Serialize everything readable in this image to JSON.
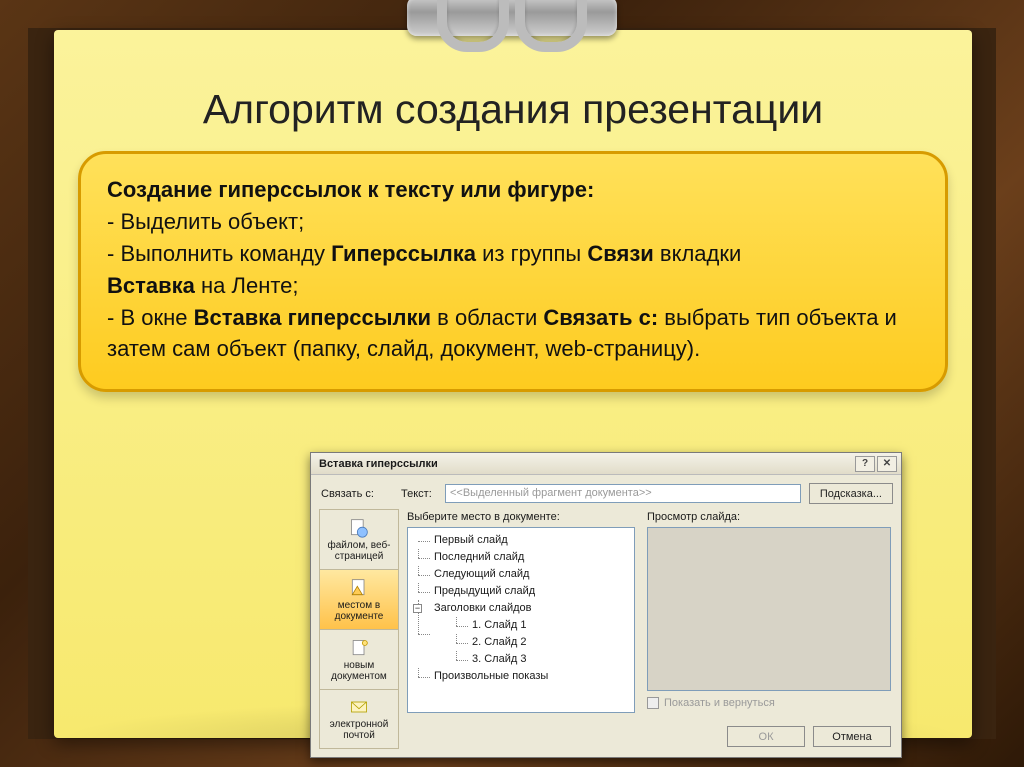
{
  "slide": {
    "title": "Алгоритм создания презентации",
    "heading": "Создание гиперссылок к тексту или фигуре:",
    "step1": "-  Выделить объект;",
    "step2_a": "-  Выполнить команду  ",
    "step2_b": "Гиперссылка",
    "step2_c": " из группы  ",
    "step2_d": "Связи",
    "step2_e": " вкладки ",
    "step2_f": "Вставка",
    "step2_g": " на Ленте;",
    "step3_a": "-  В окне ",
    "step3_b": "Вставка гиперссылки",
    "step3_c": " в области ",
    "step3_d": "Связать с:",
    "step3_e": " выбрать тип объекта и затем сам объект (папку, слайд, документ, web-страницу)."
  },
  "dialog": {
    "title": "Вставка гиперссылки",
    "link_to_label": "Связать с:",
    "text_label": "Текст:",
    "text_placeholder": "<<Выделенный фрагмент документа>>",
    "hint_btn": "Подсказка...",
    "linkto": {
      "file": "файлом, веб-страницей",
      "place": "местом в документе",
      "newdoc": "новым документом",
      "email": "электронной почтой"
    },
    "mid_label": "Выберите место в документе:",
    "tree": {
      "first": "Первый слайд",
      "last": "Последний слайд",
      "next": "Следующий слайд",
      "prev": "Предыдущий слайд",
      "titles": "Заголовки слайдов",
      "s1": "1. Слайд 1",
      "s2": "2. Слайд 2",
      "s3": "3. Слайд 3",
      "custom": "Произвольные показы"
    },
    "preview_label": "Просмотр слайда:",
    "show_return": "Показать и вернуться",
    "ok": "ОК",
    "cancel": "Отмена",
    "help_icon": "?",
    "close_icon": "✕"
  }
}
